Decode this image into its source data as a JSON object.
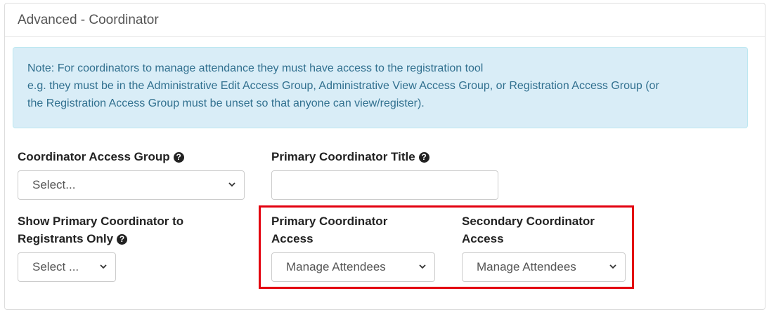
{
  "panel": {
    "title": "Advanced - Coordinator"
  },
  "note": {
    "line1": "Note: For coordinators to manage attendance they must have access to the registration tool",
    "line2": "e.g. they must be in the Administrative Edit Access Group, Administrative View Access Group, or Registration Access Group (or",
    "line3": "the Registration Access Group must be unset so that anyone can view/register)."
  },
  "fields": {
    "coordinator_access_group": {
      "label": "Coordinator Access Group",
      "value": "Select..."
    },
    "primary_coordinator_title": {
      "label": "Primary Coordinator Title",
      "value": ""
    },
    "show_primary_coordinator": {
      "label_line1": "Show Primary Coordinator to",
      "label_line2": "Registrants Only",
      "value": "Select ..."
    },
    "primary_coordinator_access": {
      "label_line1": "Primary Coordinator",
      "label_line2": "Access",
      "value": "Manage Attendees"
    },
    "secondary_coordinator_access": {
      "label_line1": "Secondary Coordinator",
      "label_line2": "Access",
      "value": "Manage Attendees"
    }
  },
  "icons": {
    "help": "question-circle-icon",
    "dropdown": "chevron-down-icon"
  },
  "colors": {
    "highlight": "#e3000f",
    "alert_bg": "#d9edf7",
    "alert_text": "#31708f"
  }
}
